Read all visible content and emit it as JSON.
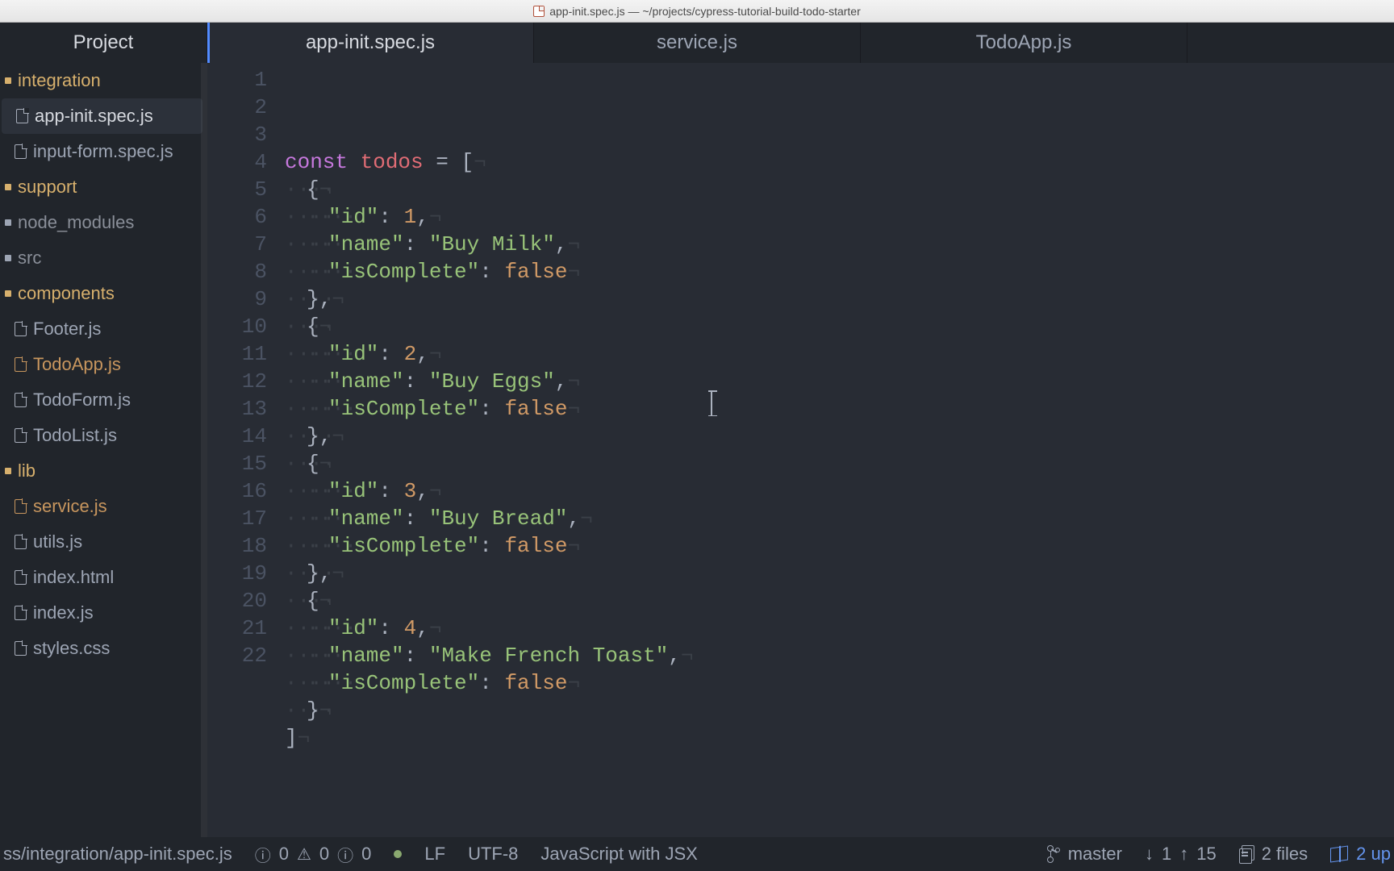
{
  "titlebar": {
    "text": "app-init.spec.js — ~/projects/cypress-tutorial-build-todo-starter"
  },
  "tabs": {
    "project": "Project",
    "items": [
      {
        "label": "app-init.spec.js",
        "active": true
      },
      {
        "label": "service.js",
        "active": false
      },
      {
        "label": "TodoApp.js",
        "active": false
      }
    ]
  },
  "tree": [
    {
      "label": "integration",
      "kind": "folder-open",
      "indent": 0
    },
    {
      "label": "app-init.spec.js",
      "kind": "file",
      "indent": 1,
      "selected": true
    },
    {
      "label": "input-form.spec.js",
      "kind": "file",
      "indent": 1
    },
    {
      "label": "support",
      "kind": "folder-open",
      "indent": 0
    },
    {
      "label": "node_modules",
      "kind": "folder-muted",
      "indent": 0
    },
    {
      "label": "src",
      "kind": "folder-muted",
      "indent": 0
    },
    {
      "label": "components",
      "kind": "folder-open",
      "indent": 0
    },
    {
      "label": "Footer.js",
      "kind": "file",
      "indent": 1
    },
    {
      "label": "TodoApp.js",
      "kind": "file-hl",
      "indent": 1
    },
    {
      "label": "TodoForm.js",
      "kind": "file",
      "indent": 1
    },
    {
      "label": "TodoList.js",
      "kind": "file",
      "indent": 1
    },
    {
      "label": "lib",
      "kind": "folder-open",
      "indent": 0
    },
    {
      "label": "service.js",
      "kind": "file-hl",
      "indent": 1
    },
    {
      "label": "utils.js",
      "kind": "file",
      "indent": 1
    },
    {
      "label": "index.html",
      "kind": "file",
      "indent": 1
    },
    {
      "label": "index.js",
      "kind": "file",
      "indent": 1
    },
    {
      "label": "styles.css",
      "kind": "file",
      "indent": 1
    }
  ],
  "code": {
    "keyword": "const",
    "varname": "todos",
    "todos": [
      {
        "id": 1,
        "name": "Buy Milk",
        "isComplete": false
      },
      {
        "id": 2,
        "name": "Buy Eggs",
        "isComplete": false
      },
      {
        "id": 3,
        "name": "Buy Bread",
        "isComplete": false
      },
      {
        "id": 4,
        "name": "Make French Toast",
        "isComplete": false
      }
    ],
    "visible_line_start": 1,
    "visible_line_end": 22
  },
  "statusbar": {
    "path": "ss/integration/app-init.spec.js",
    "diag_error": "0",
    "diag_warn": "0",
    "diag_info": "0",
    "line_ending": "LF",
    "encoding": "UTF-8",
    "grammar": "JavaScript with JSX",
    "branch": "master",
    "behind": "1",
    "ahead": "15",
    "files_changed_label": "2 files",
    "updates_label": "2 up"
  }
}
